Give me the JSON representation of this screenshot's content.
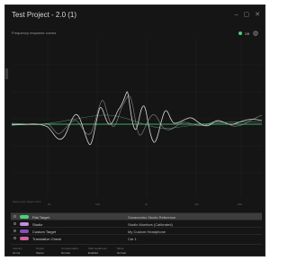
{
  "window": {
    "title": "Test Project - 2.0 (1)"
  },
  "chart": {
    "title": "Frequency response curves",
    "toggle_label": "Off"
  },
  "plot": {
    "caption": "Select your target curve",
    "x_ticks": [
      "20",
      "100",
      "1k",
      "10k",
      "20k"
    ]
  },
  "targets": [
    {
      "name": "Flat Target",
      "description": "Sonarworks Studio Reference",
      "color": "#49d17d",
      "selected": true
    },
    {
      "name": "Studio",
      "description": "Studio Monitors (Calibrated)",
      "color": "#c48fe0",
      "selected": false
    },
    {
      "name": "Custom Target",
      "description": "My Custom Headphone",
      "color": "#8a4fb8",
      "selected": false
    },
    {
      "name": "Translation Check",
      "description": "Car 1",
      "color": "#d65fa0",
      "selected": false
    }
  ],
  "footer": [
    {
      "label": "Latency",
      "value": "12 ms"
    },
    {
      "label": "Output",
      "value": "Stereo"
    },
    {
      "label": "Compensation",
      "value": "Normal"
    },
    {
      "label": "Safe Headroom",
      "value": "Enabled"
    },
    {
      "label": "Mode",
      "value": "Normal"
    }
  ],
  "colors": {
    "background": "#151515",
    "accent": "#49d17d",
    "curve": "#d0d0d0"
  }
}
